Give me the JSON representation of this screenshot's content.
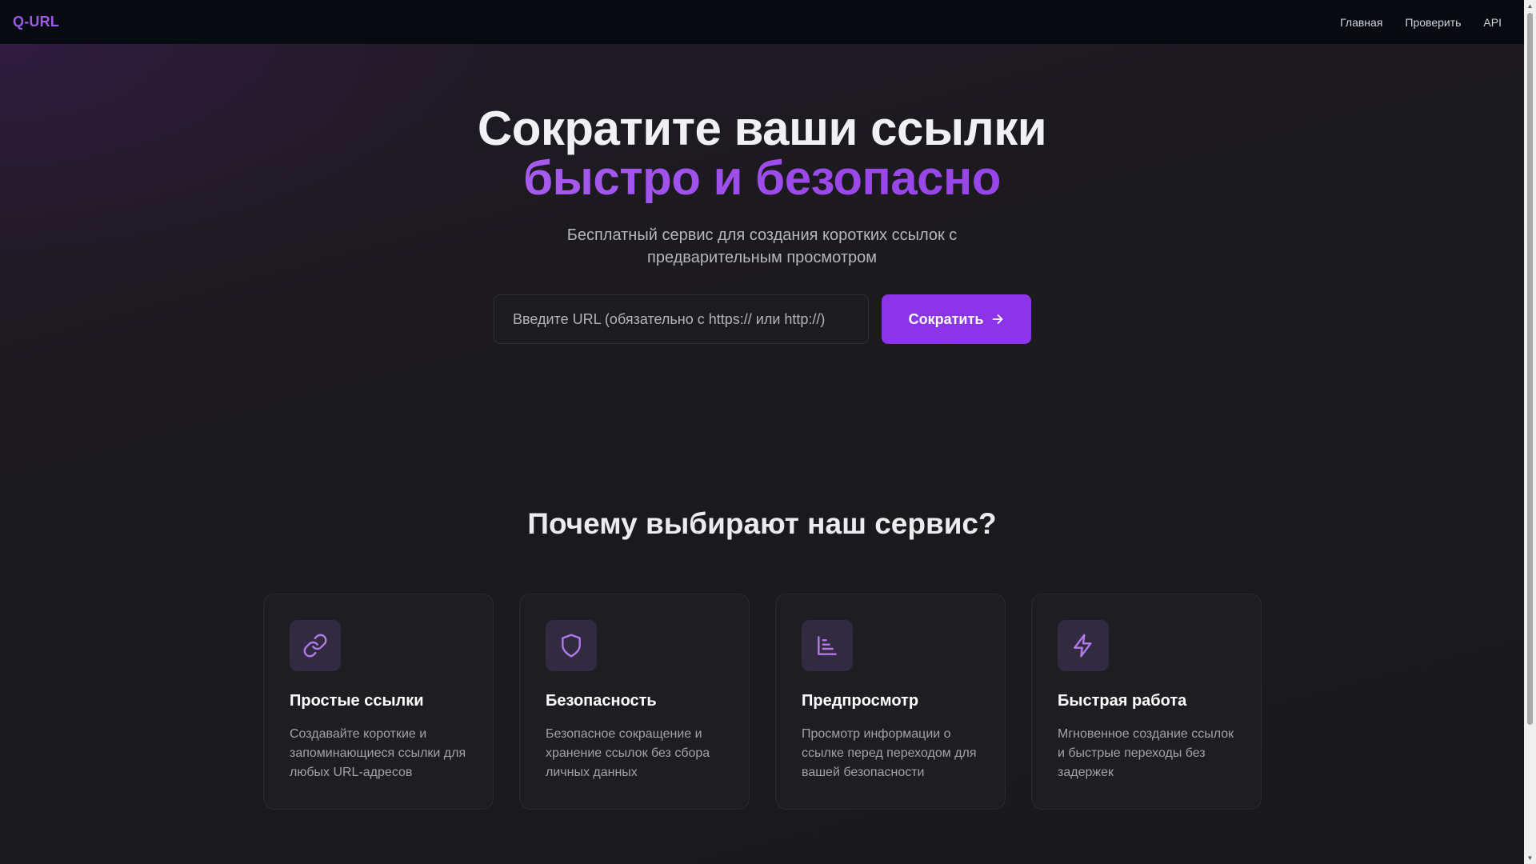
{
  "header": {
    "logo": "Q-URL",
    "nav": [
      {
        "label": "Главная"
      },
      {
        "label": "Проверить"
      },
      {
        "label": "API"
      }
    ]
  },
  "hero": {
    "title_line1": "Сократите ваши ссылки",
    "title_line2": "быстро и безопасно",
    "subtitle": "Бесплатный сервис для создания коротких ссылок с предварительным просмотром",
    "input_placeholder": "Введите URL (обязательно с https:// или http://)",
    "input_value": "",
    "submit_label": "Сократить"
  },
  "features": {
    "title": "Почему выбирают наш сервис?",
    "cards": [
      {
        "icon": "link-icon",
        "title": "Простые ссылки",
        "text": "Создавайте короткие и запоминающиеся ссылки для любых URL-адресов"
      },
      {
        "icon": "shield-icon",
        "title": "Безопасность",
        "text": "Безопасное сокращение и хранение ссылок без сбора личных данных"
      },
      {
        "icon": "chart-icon",
        "title": "Предпросмотр",
        "text": "Просмотр информации о ссылке перед переходом для вашей безопасности"
      },
      {
        "icon": "lightning-icon",
        "title": "Быстрая работа",
        "text": "Мгновенное создание ссылок и быстрые переходы без задержек"
      }
    ]
  },
  "colors": {
    "accent": "#8b34ea",
    "logo": "#9a5be8",
    "icon": "#b07ae8",
    "header_bg": "#080a12",
    "page_bg": "#1a1a1d"
  }
}
